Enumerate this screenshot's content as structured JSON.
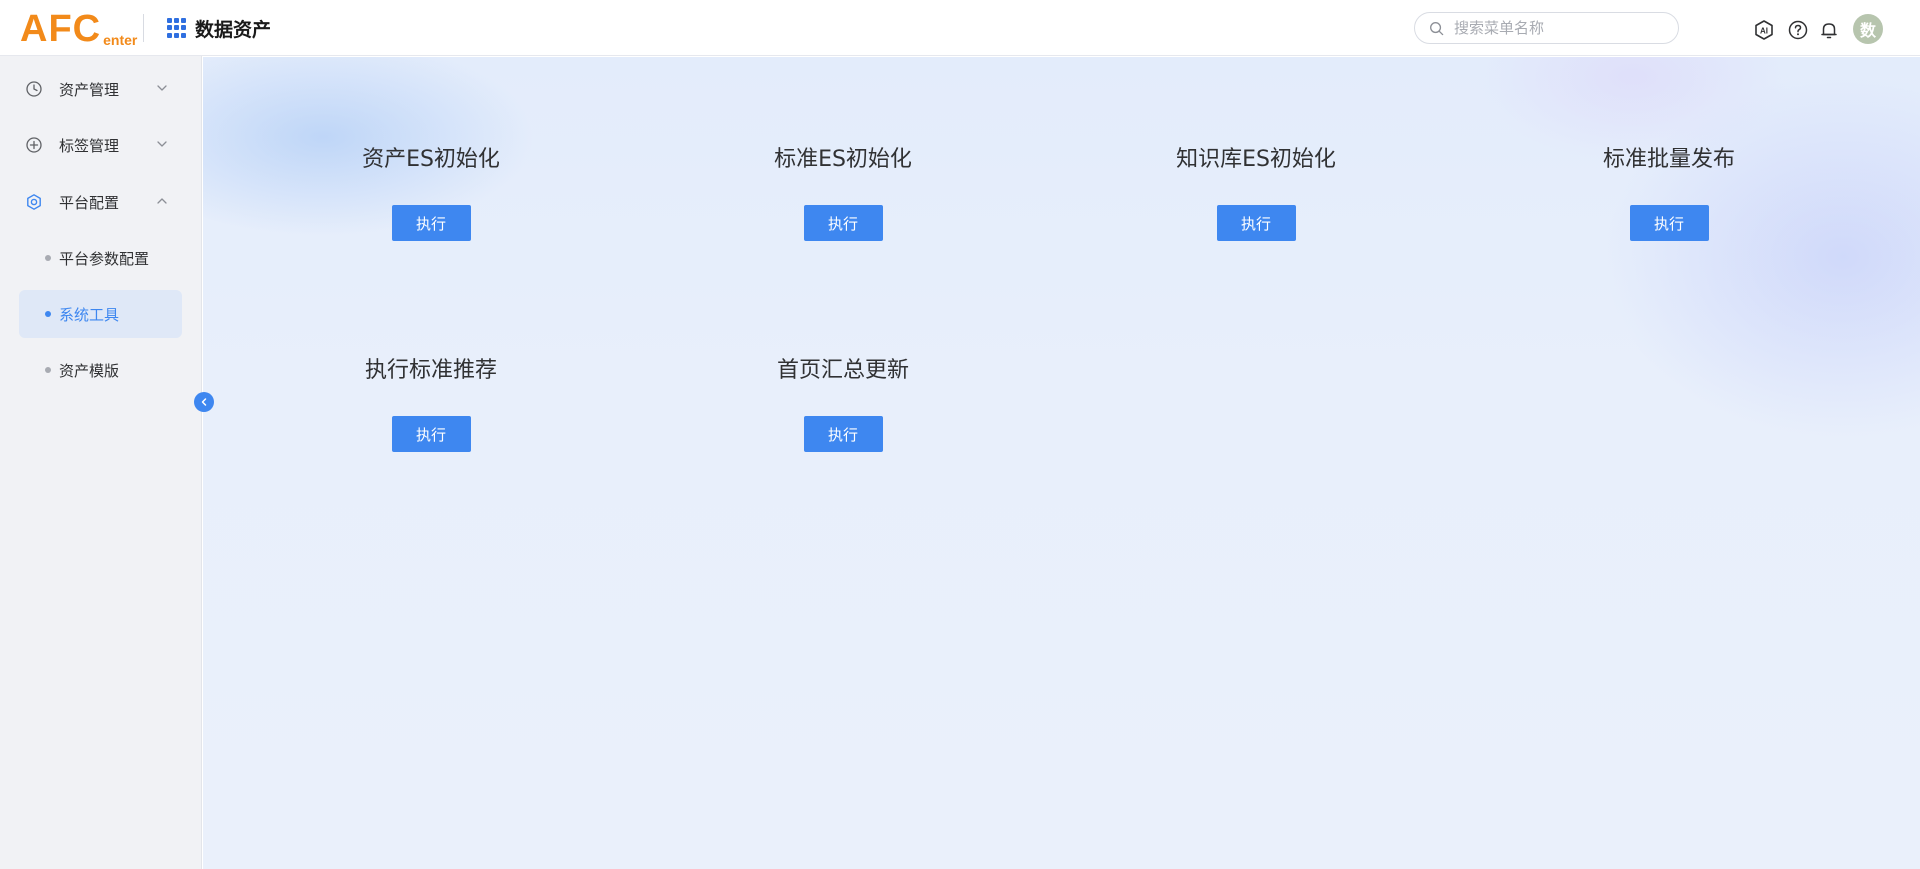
{
  "header": {
    "logo_main": "AFC",
    "logo_sub": "enter",
    "app_title": "数据资产",
    "search_placeholder": "搜索菜单名称",
    "avatar_text": "数"
  },
  "sidebar": {
    "menus": [
      {
        "label": "资产管理",
        "icon": "clock-icon",
        "expanded": false
      },
      {
        "label": "标签管理",
        "icon": "plus-circle-icon",
        "expanded": false
      },
      {
        "label": "平台配置",
        "icon": "gear-icon",
        "expanded": true
      }
    ],
    "submenu": [
      {
        "label": "平台参数配置",
        "active": false
      },
      {
        "label": "系统工具",
        "active": true
      },
      {
        "label": "资产模版",
        "active": false
      }
    ]
  },
  "tools": [
    {
      "title": "资产ES初始化",
      "button": "执行"
    },
    {
      "title": "标准ES初始化",
      "button": "执行"
    },
    {
      "title": "知识库ES初始化",
      "button": "执行"
    },
    {
      "title": "标准批量发布",
      "button": "执行"
    },
    {
      "title": "执行标准推荐",
      "button": "执行"
    },
    {
      "title": "首页汇总更新",
      "button": "执行"
    }
  ],
  "colors": {
    "brand_orange": "#f28a1a",
    "accent_blue": "#3e87f0",
    "active_bg": "#dfe8f7"
  }
}
